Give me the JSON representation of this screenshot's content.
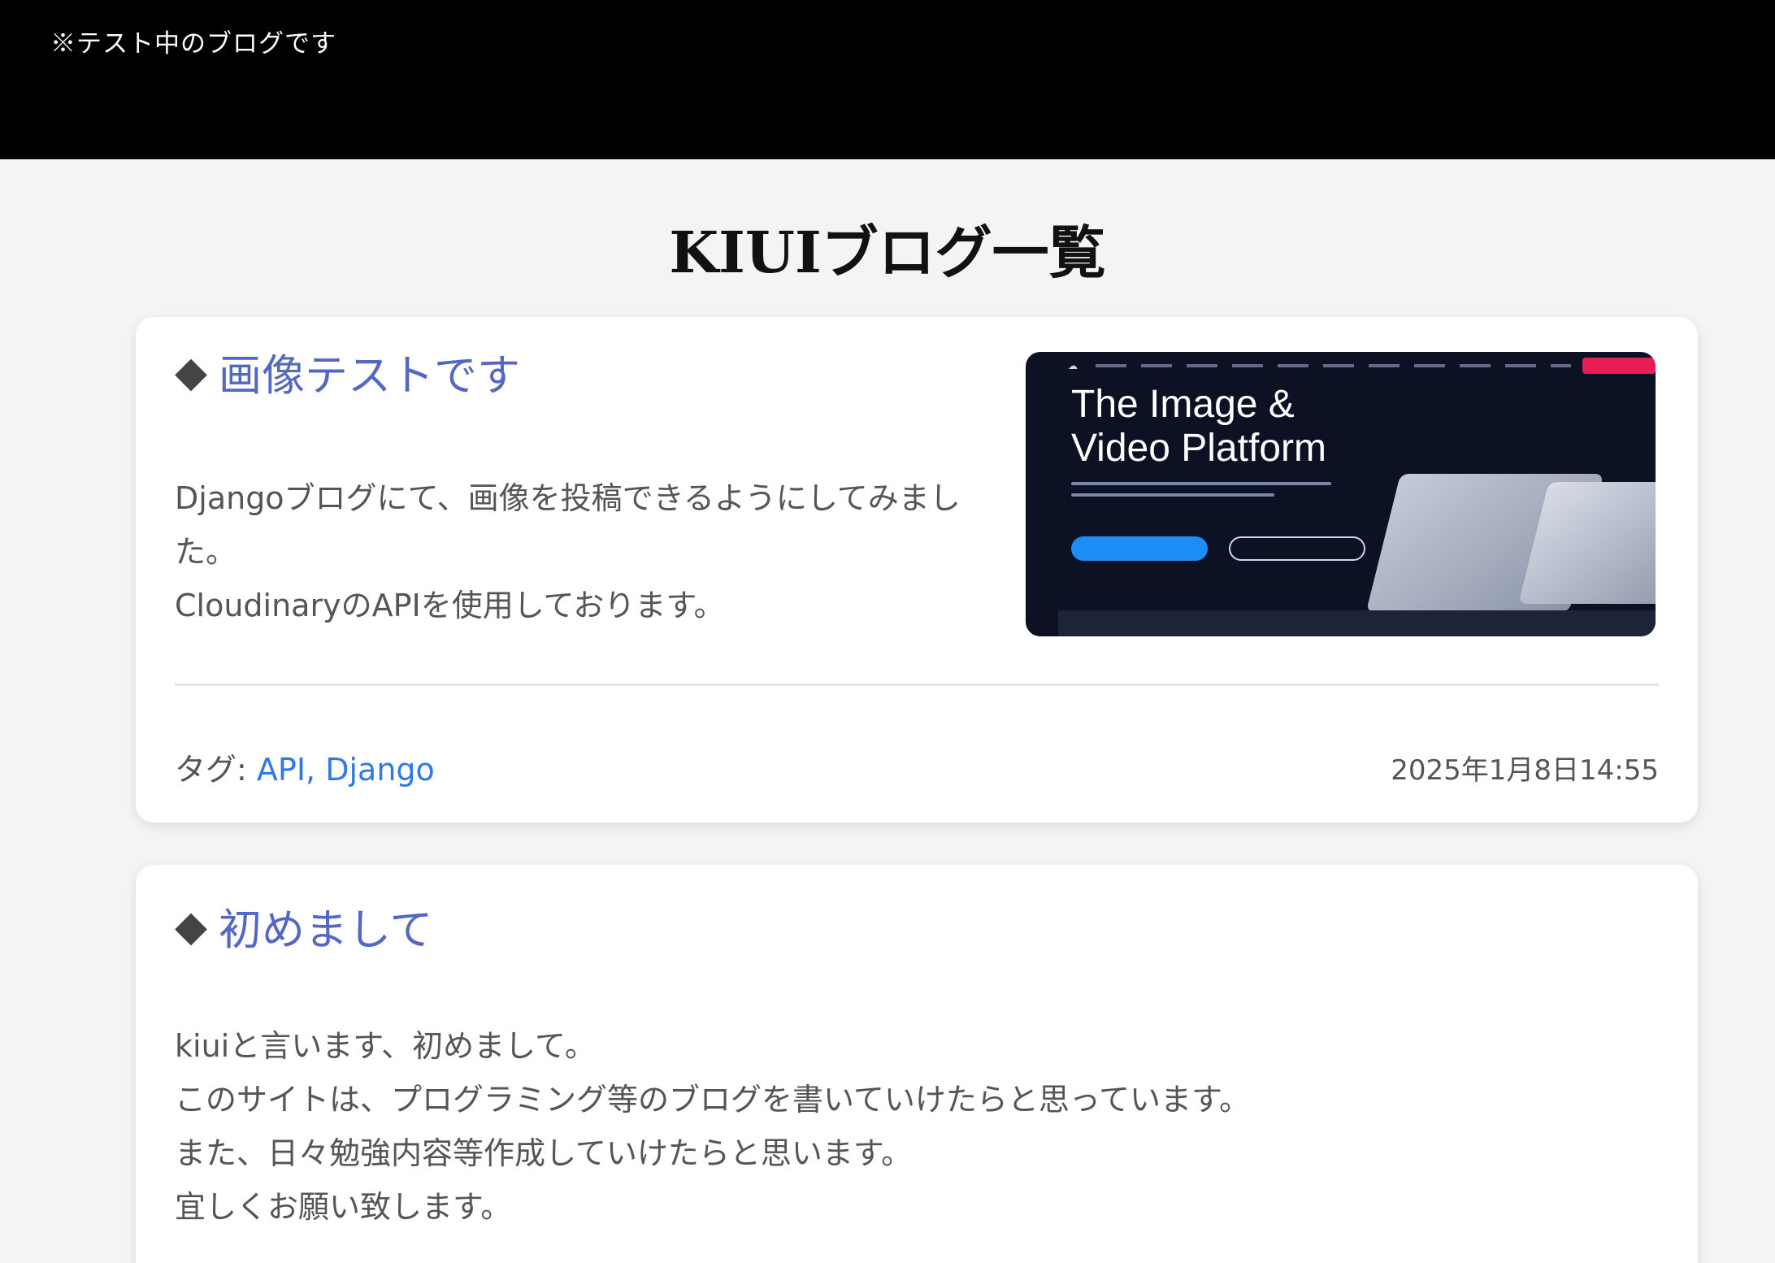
{
  "header": {
    "notice": "※テスト中のブログです"
  },
  "page": {
    "title": "KIUIブログ一覧"
  },
  "posts": [
    {
      "title": "画像テストです",
      "excerpt_lines": [
        "Djangoブログにて、画像を投稿できるようにしてみました。",
        "CloudinaryのAPIを使用しております。"
      ],
      "thumbnail": {
        "headline_line1": "The Image &",
        "headline_line2": "Video Platform"
      },
      "tags_label": "タグ:",
      "tags": [
        "API",
        "Django"
      ],
      "tag_separator": ",",
      "date": "2025年1月8日14:55"
    },
    {
      "title": "初めまして",
      "excerpt_lines": [
        "kiuiと言います、初めまして。",
        "このサイトは、プログラミング等のブログを書いていけたらと思っています。",
        "また、日々勉強内容等作成していけたらと思います。",
        "宜しくお願い致します。"
      ]
    }
  ],
  "icons": {
    "bullet": "diamond-icon"
  },
  "colors": {
    "title_link": "#5467c2",
    "tag_link": "#2f7ae5",
    "header_bg": "#000000"
  }
}
